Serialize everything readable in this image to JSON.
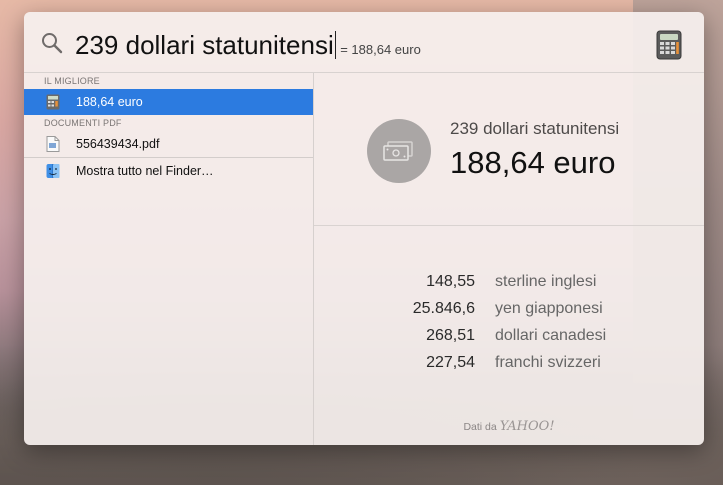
{
  "search": {
    "query": "239 dollari statunitensi",
    "hint": "= 188,64 euro"
  },
  "sections": [
    {
      "header": "IL MIGLIORE",
      "items": [
        {
          "label": "188,64 euro",
          "icon": "calculator-icon",
          "selected": true
        }
      ]
    },
    {
      "header": "DOCUMENTI PDF",
      "items": [
        {
          "label": "556439434.pdf",
          "icon": "pdf-file-icon",
          "selected": false
        }
      ]
    }
  ],
  "finder_item": {
    "label": "Mostra tutto nel Finder…",
    "icon": "finder-icon"
  },
  "preview": {
    "icon": "currency-bills-icon",
    "title": "239 dollari statunitensi",
    "value": "188,64 euro",
    "conversions": [
      {
        "amount": "148,55",
        "currency": "sterline inglesi"
      },
      {
        "amount": "25.846,6",
        "currency": "yen giapponesi"
      },
      {
        "amount": "268,51",
        "currency": "dollari canadesi"
      },
      {
        "amount": "227,54",
        "currency": "franchi svizzeri"
      }
    ],
    "footer_label": "Dati da",
    "footer_brand": "YAHOO!"
  },
  "colors": {
    "selection": "#2c7be0",
    "hero_circle": "#aaa6a5"
  }
}
